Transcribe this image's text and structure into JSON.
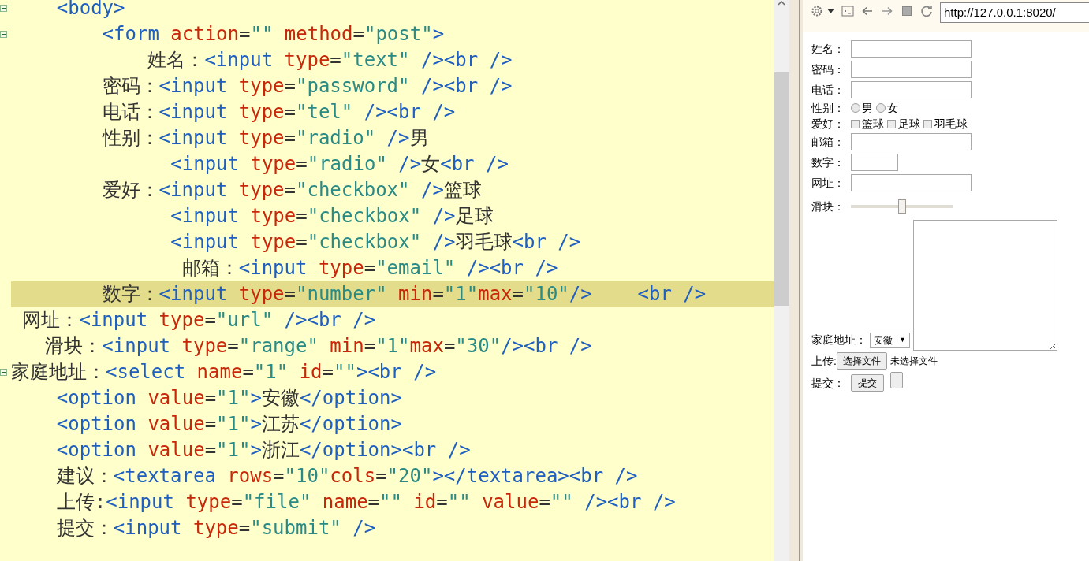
{
  "editor": {
    "lines": [
      {
        "foldable": true,
        "highlighted": false,
        "tokens": [
          {
            "kind": "tag",
            "text": "    <body>"
          }
        ]
      },
      {
        "foldable": true,
        "highlighted": false,
        "tokens": [
          {
            "kind": "tag",
            "text": "        <form"
          },
          {
            "kind": "attr",
            "text": " action"
          },
          {
            "kind": "text",
            "text": "="
          },
          {
            "kind": "string",
            "text": "\"\""
          },
          {
            "kind": "attr",
            "text": " method"
          },
          {
            "kind": "text",
            "text": "="
          },
          {
            "kind": "string",
            "text": "\"post\""
          },
          {
            "kind": "tag",
            "text": ">"
          }
        ]
      },
      {
        "foldable": false,
        "highlighted": false,
        "tokens": [
          {
            "kind": "text",
            "text": "            姓名："
          },
          {
            "kind": "tag",
            "text": "<input"
          },
          {
            "kind": "attr",
            "text": " type"
          },
          {
            "kind": "text",
            "text": "="
          },
          {
            "kind": "string",
            "text": "\"text\""
          },
          {
            "kind": "tag",
            "text": " /><br />"
          }
        ]
      },
      {
        "foldable": false,
        "highlighted": false,
        "tokens": [
          {
            "kind": "text",
            "text": "        密码："
          },
          {
            "kind": "tag",
            "text": "<input"
          },
          {
            "kind": "attr",
            "text": " type"
          },
          {
            "kind": "text",
            "text": "="
          },
          {
            "kind": "string",
            "text": "\"password\""
          },
          {
            "kind": "tag",
            "text": " /><br />"
          }
        ]
      },
      {
        "foldable": false,
        "highlighted": false,
        "tokens": [
          {
            "kind": "text",
            "text": "        电话："
          },
          {
            "kind": "tag",
            "text": "<input"
          },
          {
            "kind": "attr",
            "text": " type"
          },
          {
            "kind": "text",
            "text": "="
          },
          {
            "kind": "string",
            "text": "\"tel\""
          },
          {
            "kind": "tag",
            "text": " /><br />"
          }
        ]
      },
      {
        "foldable": false,
        "highlighted": false,
        "tokens": [
          {
            "kind": "text",
            "text": "        性别："
          },
          {
            "kind": "tag",
            "text": "<input"
          },
          {
            "kind": "attr",
            "text": " type"
          },
          {
            "kind": "text",
            "text": "="
          },
          {
            "kind": "string",
            "text": "\"radio\""
          },
          {
            "kind": "tag",
            "text": " />"
          },
          {
            "kind": "text",
            "text": "男"
          }
        ]
      },
      {
        "foldable": false,
        "highlighted": false,
        "tokens": [
          {
            "kind": "tag",
            "text": "              <input"
          },
          {
            "kind": "attr",
            "text": " type"
          },
          {
            "kind": "text",
            "text": "="
          },
          {
            "kind": "string",
            "text": "\"radio\""
          },
          {
            "kind": "tag",
            "text": " />"
          },
          {
            "kind": "text",
            "text": "女"
          },
          {
            "kind": "tag",
            "text": "<br />"
          }
        ]
      },
      {
        "foldable": false,
        "highlighted": false,
        "tokens": [
          {
            "kind": "text",
            "text": "        爱好："
          },
          {
            "kind": "tag",
            "text": "<input"
          },
          {
            "kind": "attr",
            "text": " type"
          },
          {
            "kind": "text",
            "text": "="
          },
          {
            "kind": "string",
            "text": "\"checkbox\""
          },
          {
            "kind": "tag",
            "text": " />"
          },
          {
            "kind": "text",
            "text": "篮球"
          }
        ]
      },
      {
        "foldable": false,
        "highlighted": false,
        "tokens": [
          {
            "kind": "tag",
            "text": "              <input"
          },
          {
            "kind": "attr",
            "text": " type"
          },
          {
            "kind": "text",
            "text": "="
          },
          {
            "kind": "string",
            "text": "\"checkbox\""
          },
          {
            "kind": "tag",
            "text": " />"
          },
          {
            "kind": "text",
            "text": "足球"
          }
        ]
      },
      {
        "foldable": false,
        "highlighted": false,
        "tokens": [
          {
            "kind": "tag",
            "text": "              <input"
          },
          {
            "kind": "attr",
            "text": " type"
          },
          {
            "kind": "text",
            "text": "="
          },
          {
            "kind": "string",
            "text": "\"checkbox\""
          },
          {
            "kind": "tag",
            "text": " />"
          },
          {
            "kind": "text",
            "text": "羽毛球"
          },
          {
            "kind": "tag",
            "text": "<br />"
          }
        ]
      },
      {
        "foldable": false,
        "highlighted": false,
        "tokens": [
          {
            "kind": "text",
            "text": "               邮箱："
          },
          {
            "kind": "tag",
            "text": "<input"
          },
          {
            "kind": "attr",
            "text": " type"
          },
          {
            "kind": "text",
            "text": "="
          },
          {
            "kind": "string",
            "text": "\"email\""
          },
          {
            "kind": "tag",
            "text": " /><br />"
          }
        ]
      },
      {
        "foldable": false,
        "highlighted": true,
        "tokens": [
          {
            "kind": "text",
            "text": "        数字："
          },
          {
            "kind": "tag",
            "text": "<input"
          },
          {
            "kind": "attr",
            "text": " type"
          },
          {
            "kind": "text",
            "text": "="
          },
          {
            "kind": "string",
            "text": "\"number\""
          },
          {
            "kind": "attr",
            "text": " min"
          },
          {
            "kind": "text",
            "text": "="
          },
          {
            "kind": "string",
            "text": "\"1\""
          },
          {
            "kind": "attr",
            "text": "max"
          },
          {
            "kind": "text",
            "text": "="
          },
          {
            "kind": "string",
            "text": "\"10\""
          },
          {
            "kind": "tag",
            "text": "/>    <br />"
          }
        ]
      },
      {
        "foldable": false,
        "highlighted": false,
        "tokens": [
          {
            "kind": "text",
            "text": " 网址："
          },
          {
            "kind": "tag",
            "text": "<input"
          },
          {
            "kind": "attr",
            "text": " type"
          },
          {
            "kind": "text",
            "text": "="
          },
          {
            "kind": "string",
            "text": "\"url\""
          },
          {
            "kind": "tag",
            "text": " /><br />"
          }
        ]
      },
      {
        "foldable": false,
        "highlighted": false,
        "tokens": [
          {
            "kind": "text",
            "text": "   滑块："
          },
          {
            "kind": "tag",
            "text": "<input"
          },
          {
            "kind": "attr",
            "text": " type"
          },
          {
            "kind": "text",
            "text": "="
          },
          {
            "kind": "string",
            "text": "\"range\""
          },
          {
            "kind": "attr",
            "text": " min"
          },
          {
            "kind": "text",
            "text": "="
          },
          {
            "kind": "string",
            "text": "\"1\""
          },
          {
            "kind": "attr",
            "text": "max"
          },
          {
            "kind": "text",
            "text": "="
          },
          {
            "kind": "string",
            "text": "\"30\""
          },
          {
            "kind": "tag",
            "text": "/><br />"
          }
        ]
      },
      {
        "foldable": true,
        "highlighted": false,
        "tokens": [
          {
            "kind": "text",
            "text": "家庭地址："
          },
          {
            "kind": "tag",
            "text": "<select"
          },
          {
            "kind": "attr",
            "text": " name"
          },
          {
            "kind": "text",
            "text": "="
          },
          {
            "kind": "string",
            "text": "\"1\""
          },
          {
            "kind": "attr",
            "text": " id"
          },
          {
            "kind": "text",
            "text": "="
          },
          {
            "kind": "string",
            "text": "\"\""
          },
          {
            "kind": "tag",
            "text": "><br />"
          }
        ]
      },
      {
        "foldable": false,
        "highlighted": false,
        "tokens": [
          {
            "kind": "tag",
            "text": "    <option"
          },
          {
            "kind": "attr",
            "text": " value"
          },
          {
            "kind": "text",
            "text": "="
          },
          {
            "kind": "string",
            "text": "\"1\""
          },
          {
            "kind": "tag",
            "text": ">"
          },
          {
            "kind": "text",
            "text": "安徽"
          },
          {
            "kind": "tag",
            "text": "</option>"
          }
        ]
      },
      {
        "foldable": false,
        "highlighted": false,
        "tokens": [
          {
            "kind": "tag",
            "text": "    <option"
          },
          {
            "kind": "attr",
            "text": " value"
          },
          {
            "kind": "text",
            "text": "="
          },
          {
            "kind": "string",
            "text": "\"1\""
          },
          {
            "kind": "tag",
            "text": ">"
          },
          {
            "kind": "text",
            "text": "江苏"
          },
          {
            "kind": "tag",
            "text": "</option>"
          }
        ]
      },
      {
        "foldable": false,
        "highlighted": false,
        "tokens": [
          {
            "kind": "tag",
            "text": "    <option"
          },
          {
            "kind": "attr",
            "text": " value"
          },
          {
            "kind": "text",
            "text": "="
          },
          {
            "kind": "string",
            "text": "\"1\""
          },
          {
            "kind": "tag",
            "text": ">"
          },
          {
            "kind": "text",
            "text": "浙江"
          },
          {
            "kind": "tag",
            "text": "</option><br />"
          }
        ]
      },
      {
        "foldable": false,
        "highlighted": false,
        "tokens": [
          {
            "kind": "text",
            "text": "    建议："
          },
          {
            "kind": "tag",
            "text": "<textarea"
          },
          {
            "kind": "attr",
            "text": " rows"
          },
          {
            "kind": "text",
            "text": "="
          },
          {
            "kind": "string",
            "text": "\"10\""
          },
          {
            "kind": "attr",
            "text": "cols"
          },
          {
            "kind": "text",
            "text": "="
          },
          {
            "kind": "string",
            "text": "\"20\""
          },
          {
            "kind": "tag",
            "text": "></textarea><br />"
          }
        ]
      },
      {
        "foldable": false,
        "highlighted": false,
        "tokens": [
          {
            "kind": "text",
            "text": "    上传:"
          },
          {
            "kind": "tag",
            "text": "<input"
          },
          {
            "kind": "attr",
            "text": " type"
          },
          {
            "kind": "text",
            "text": "="
          },
          {
            "kind": "string",
            "text": "\"file\""
          },
          {
            "kind": "attr",
            "text": " name"
          },
          {
            "kind": "text",
            "text": "="
          },
          {
            "kind": "string",
            "text": "\"\""
          },
          {
            "kind": "attr",
            "text": " id"
          },
          {
            "kind": "text",
            "text": "="
          },
          {
            "kind": "string",
            "text": "\"\""
          },
          {
            "kind": "attr",
            "text": " value"
          },
          {
            "kind": "text",
            "text": "="
          },
          {
            "kind": "string",
            "text": "\"\""
          },
          {
            "kind": "tag",
            "text": " /><br />"
          }
        ]
      },
      {
        "foldable": false,
        "highlighted": false,
        "tokens": [
          {
            "kind": "text",
            "text": "    提交："
          },
          {
            "kind": "tag",
            "text": "<input"
          },
          {
            "kind": "attr",
            "text": " type"
          },
          {
            "kind": "text",
            "text": "="
          },
          {
            "kind": "string",
            "text": "\"submit\""
          },
          {
            "kind": "tag",
            "text": " />"
          }
        ]
      }
    ]
  },
  "preview": {
    "url": "http://127.0.0.1:8020/",
    "fields": [
      {
        "kind": "text",
        "label": "姓名："
      },
      {
        "kind": "text",
        "label": "密码："
      },
      {
        "kind": "text",
        "label": "电话："
      },
      {
        "kind": "radio",
        "label": "性别：",
        "options": [
          {
            "label": "男",
            "selected": false
          },
          {
            "label": "女",
            "selected": false
          }
        ]
      },
      {
        "kind": "checkbox",
        "label": "爱好：",
        "options": [
          {
            "label": "篮球",
            "checked": false
          },
          {
            "label": "足球",
            "checked": false
          },
          {
            "label": "羽毛球",
            "checked": false
          }
        ]
      },
      {
        "kind": "text",
        "label": "邮箱："
      },
      {
        "kind": "number",
        "label": "数字："
      },
      {
        "kind": "text",
        "label": "网址："
      },
      {
        "kind": "range",
        "label": "滑块：",
        "level": 0.5
      },
      {
        "kind": "select",
        "label": "家庭地址：",
        "value": "安徽",
        "caret": "▼",
        "textarea": true
      },
      {
        "kind": "file",
        "label": "上传:",
        "button": "选择文件",
        "status": "未选择文件"
      },
      {
        "kind": "submit",
        "label": "提交：",
        "button": "提交"
      }
    ]
  }
}
